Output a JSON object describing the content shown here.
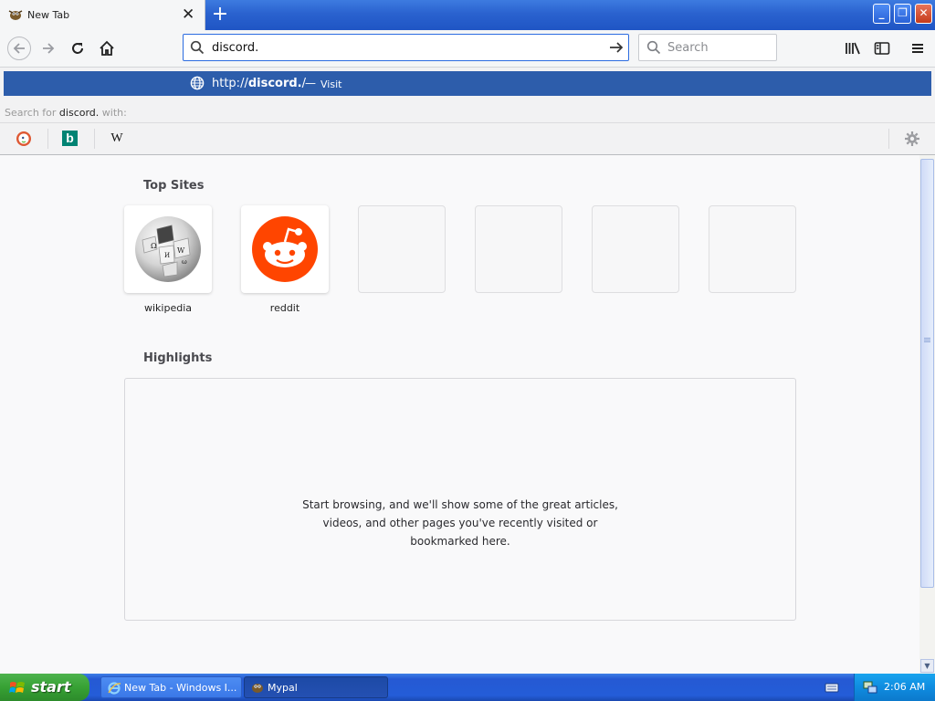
{
  "window": {
    "tab_title": "New Tab",
    "tab_close": "✕",
    "newtab_symbol": "+",
    "btn_minimize": "_",
    "btn_restore": "❐",
    "btn_close": "✕"
  },
  "toolbar": {
    "url_value": "discord.",
    "search_placeholder": "Search"
  },
  "popup": {
    "suggestion_prefix": "http://",
    "suggestion_bold": "discord.",
    "suggestion_suffix": "/",
    "suggestion_dash": "—",
    "suggestion_action": "Visit",
    "search_for_prefix": "Search for ",
    "search_for_term": "discord.",
    "search_for_suffix": " with:",
    "engines": [
      {
        "name": "DuckDuckGo",
        "icon": "duckduckgo-icon"
      },
      {
        "name": "Bing",
        "icon": "bing-icon",
        "glyph": "b"
      },
      {
        "name": "Wikipedia",
        "icon": "wikipedia-icon",
        "glyph": "W"
      }
    ]
  },
  "page": {
    "top_sites_title": "Top Sites",
    "top_sites": [
      {
        "label": "wikipedia",
        "icon": "wikipedia-globe-icon"
      },
      {
        "label": "reddit",
        "icon": "reddit-icon"
      }
    ],
    "highlights_title": "Highlights",
    "highlights_message": [
      "Start browsing, and we'll show some of the great articles,",
      "videos, and other pages you've recently visited or",
      "bookmarked here."
    ]
  },
  "taskbar": {
    "start_label": "start",
    "tasks": [
      {
        "label": "New Tab - Windows I...",
        "icon": "internet-explorer-icon"
      },
      {
        "label": "Mypal",
        "icon": "mypal-icon"
      }
    ],
    "clock": "2:06 AM"
  },
  "colors": {
    "accent": "#2c6ce1",
    "suggestion_bg": "#2d5dab",
    "reddit": "#ff4500",
    "taskbar": "#245dd8",
    "start_green": "#37a134"
  }
}
